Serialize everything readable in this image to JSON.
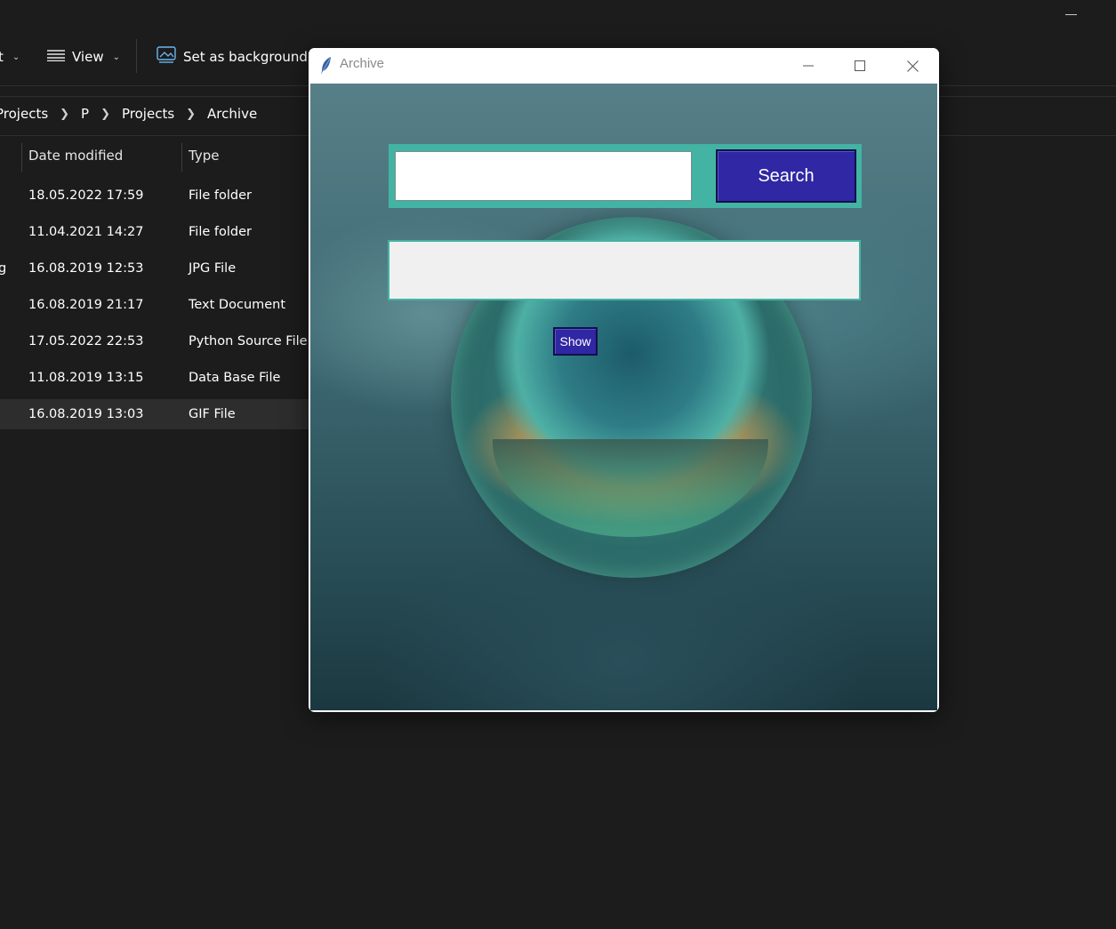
{
  "explorer": {
    "toolbar": {
      "partial_left_item": "t",
      "view_label": "View",
      "set_background_label": "Set as background"
    },
    "breadcrumb": [
      "Projects",
      "P",
      "Projects",
      "Archive"
    ],
    "columns": {
      "date_modified": "Date modified",
      "type": "Type"
    },
    "rows": [
      {
        "name_fragment": "",
        "date": "18.05.2022 17:59",
        "type": "File folder",
        "selected": false
      },
      {
        "name_fragment": "",
        "date": "11.04.2021 14:27",
        "type": "File folder",
        "selected": false
      },
      {
        "name_fragment": "g",
        "date": "16.08.2019 12:53",
        "type": "JPG File",
        "selected": false
      },
      {
        "name_fragment": "",
        "date": "16.08.2019 21:17",
        "type": "Text Document",
        "selected": false
      },
      {
        "name_fragment": "",
        "date": "17.05.2022 22:53",
        "type": "Python Source File",
        "selected": false
      },
      {
        "name_fragment": "",
        "date": "11.08.2019 13:15",
        "type": "Data Base File",
        "selected": false
      },
      {
        "name_fragment": "",
        "date": "16.08.2019 13:03",
        "type": "GIF File",
        "selected": true
      }
    ]
  },
  "archive_window": {
    "title": "Archive",
    "search": {
      "value": "",
      "placeholder": "",
      "button_label": "Search"
    },
    "result_text": "",
    "show_button_label": "Show"
  },
  "colors": {
    "explorer_bg": "#1c1c1c",
    "teal_frame": "#43b3a3",
    "button_blue": "#3027a4"
  },
  "icons": [
    "view-list-icon",
    "chevron-down-icon",
    "set-background-icon",
    "feather-icon",
    "minimize-icon",
    "maximize-icon",
    "close-icon"
  ]
}
